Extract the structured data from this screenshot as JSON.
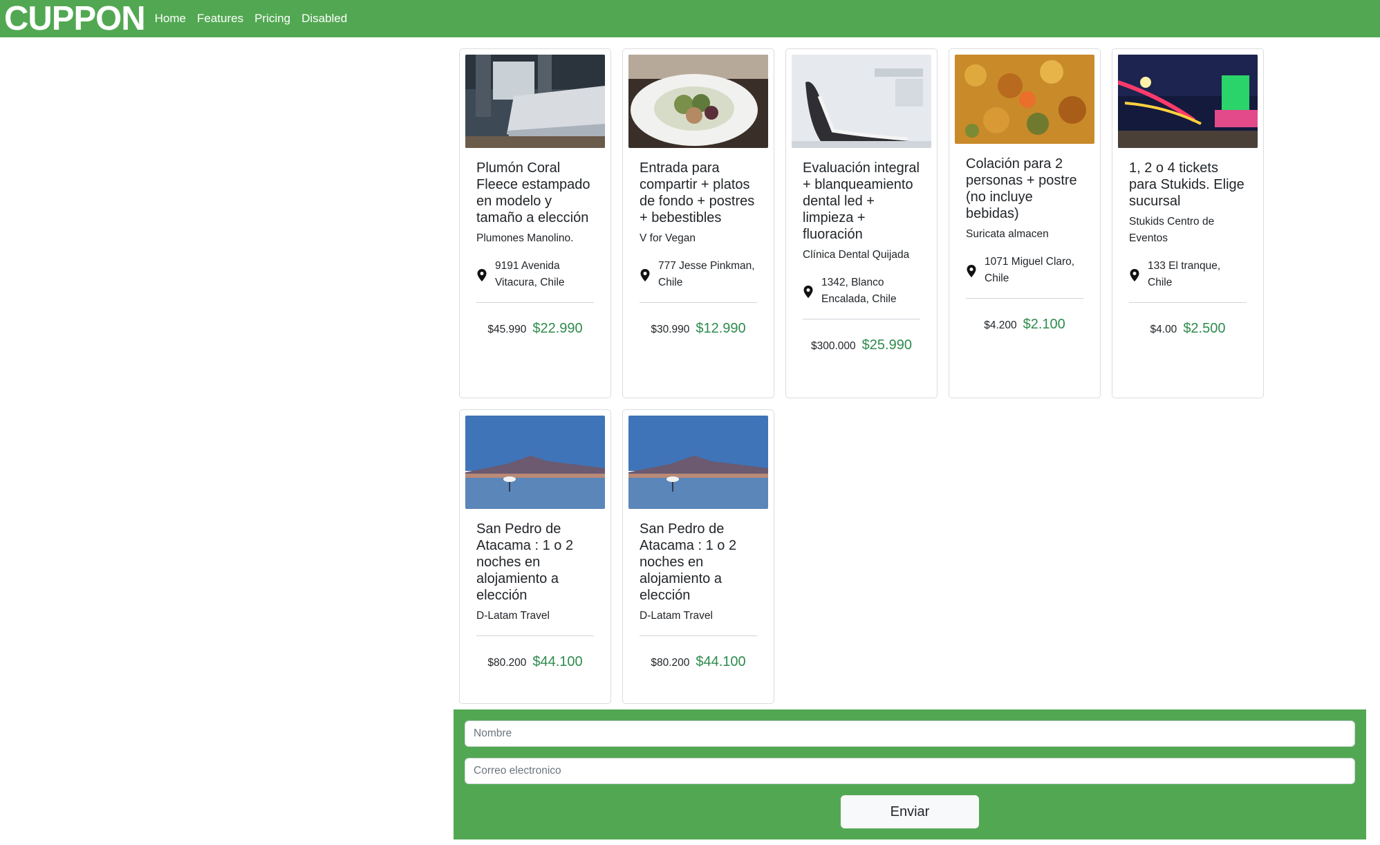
{
  "navbar": {
    "brand": "CUPPON",
    "links": [
      "Home",
      "Features",
      "Pricing",
      "Disabled"
    ]
  },
  "products": [
    {
      "title": "Plumón Coral Fleece estampado en modelo y tamaño a elección",
      "vendor": "Plumones Manolino.",
      "address": "9191 Avenida Vitacura, Chile",
      "old_price": "$45.990",
      "new_price": "$22.990",
      "image": "bedroom"
    },
    {
      "title": "Entrada para compartir + platos de fondo + postres + bebestibles",
      "vendor": "V for Vegan",
      "address": "777 Jesse Pinkman, Chile",
      "old_price": "$30.990",
      "new_price": "$12.990",
      "image": "salad-plate"
    },
    {
      "title": "Evaluación integral + blanqueamiento dental led + limpieza + fluoración",
      "vendor": "Clínica Dental Quijada",
      "address": "1342, Blanco Encalada, Chile",
      "old_price": "$300.000",
      "new_price": "$25.990",
      "image": "dental-chair"
    },
    {
      "title": "Colación para 2 personas + postre (no incluye bebidas)",
      "vendor": "Suricata almacen",
      "address": "1071 Miguel Claro, Chile",
      "old_price": "$4.200",
      "new_price": "$2.100",
      "image": "stew"
    },
    {
      "title": "1, 2 o 4 tickets para Stukids. Elige sucursal",
      "vendor": "Stukids Centro de Eventos",
      "address": "133 El tranque, Chile",
      "old_price": "$4.00",
      "new_price": "$2.500",
      "image": "fairground-night"
    },
    {
      "title": "San Pedro de Atacama : 1 o 2 noches en alojamiento a elección",
      "vendor": "D-Latam Travel",
      "address": "",
      "old_price": "$80.200",
      "new_price": "$44.100",
      "image": "lagoon-flamingo"
    },
    {
      "title": "San Pedro de Atacama : 1 o 2 noches en alojamiento a elección",
      "vendor": "D-Latam Travel",
      "address": "",
      "old_price": "$80.200",
      "new_price": "$44.100",
      "image": "lagoon-flamingo"
    }
  ],
  "form": {
    "name_placeholder": "Nombre",
    "email_placeholder": "Correo electronico",
    "submit_label": "Enviar"
  },
  "colors": {
    "brand_green": "#52a852",
    "price_green": "#2e8b4e"
  },
  "icons": {
    "address": "map-pin-icon"
  }
}
